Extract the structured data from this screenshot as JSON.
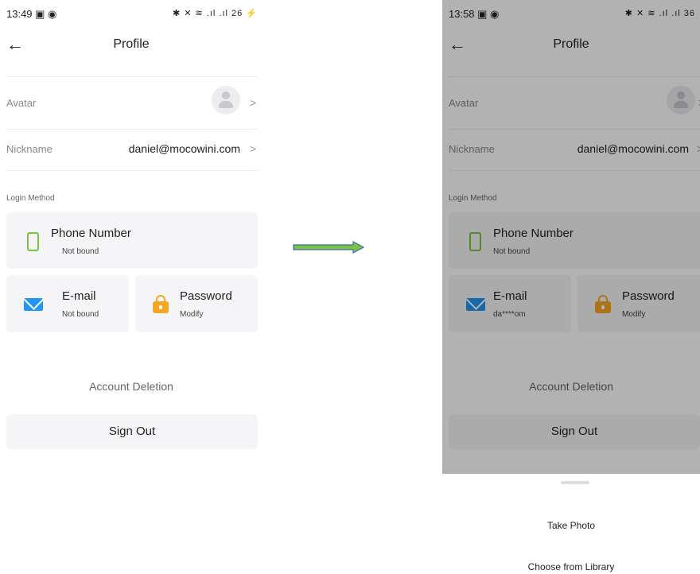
{
  "left": {
    "status": {
      "time": "13:49 ▣ ◉",
      "icons": "✱ ✕ ≋ .ıl .ıl 26 ⚡"
    },
    "header": {
      "back_icon": "←",
      "title": "Profile"
    },
    "rows": {
      "avatar": {
        "label": "Avatar",
        "chevron": ">"
      },
      "nickname": {
        "label": "Nickname",
        "value": "daniel@mocowini.com",
        "chevron": ">"
      }
    },
    "login": {
      "label": "Login Method",
      "phone": {
        "title": "Phone Number",
        "status": "Not bound"
      },
      "email": {
        "title": "E-mail",
        "status": "Not bound"
      },
      "password": {
        "title": "Password",
        "status": "Modify"
      }
    },
    "account_deletion": "Account Deletion",
    "sign_out": "Sign Out"
  },
  "right": {
    "status": {
      "time": "13:58 ▣ ◉",
      "icons": "✱ ✕ ≋ .ıl .ıl 36"
    },
    "header": {
      "back_icon": "←",
      "title": "Profile"
    },
    "rows": {
      "avatar": {
        "label": "Avatar",
        "chevron": ">"
      },
      "nickname": {
        "label": "Nickname",
        "value": "daniel@mocowini.com",
        "chevron": ">"
      }
    },
    "login": {
      "label": "Login Method",
      "phone": {
        "title": "Phone Number",
        "status": "Not bound"
      },
      "email": {
        "title": "E-mail",
        "status": "da****om"
      },
      "password": {
        "title": "Password",
        "status": "Modify"
      }
    },
    "account_deletion": "Account Deletion",
    "sign_out": "Sign Out",
    "sheet": {
      "take_photo": "Take Photo",
      "choose_library": "Choose from Library"
    }
  },
  "colors": {
    "phone_icon": "#7cc243",
    "email_icon": "#2196f3",
    "lock_icon": "#f5a623",
    "arrow_fill": "#7cc243",
    "arrow_border": "#3b6bb5",
    "card_bg": "#f5f5f7"
  },
  "icons": [
    "back-arrow-icon",
    "avatar-icon",
    "chevron-right-icon",
    "phone-icon",
    "email-icon",
    "lock-icon",
    "transition-arrow-icon"
  ]
}
